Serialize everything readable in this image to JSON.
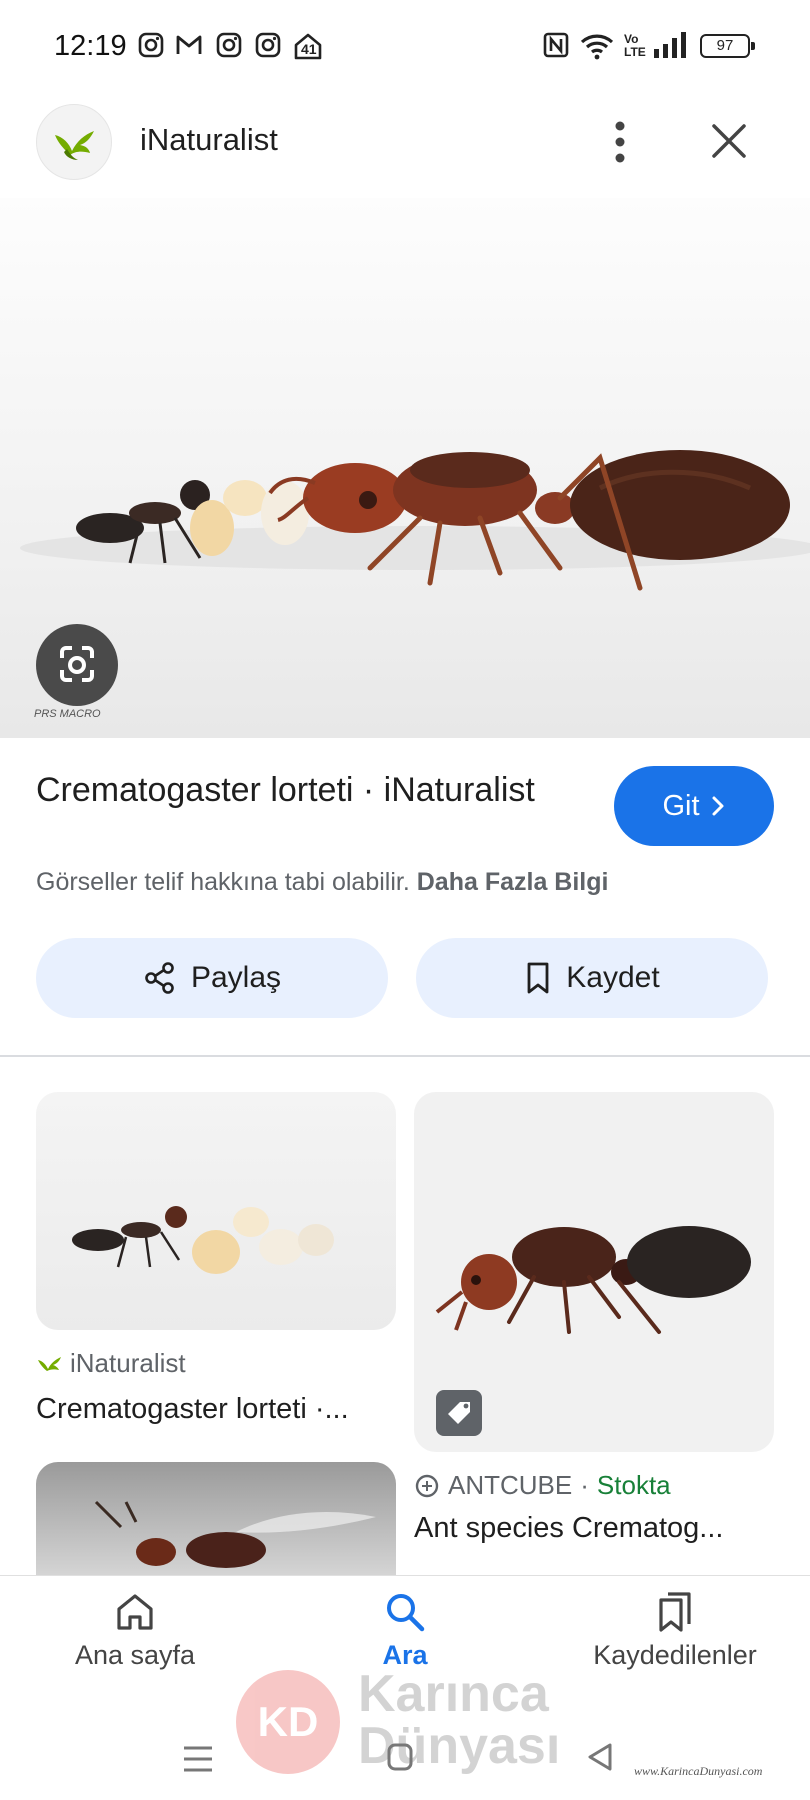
{
  "status_bar": {
    "time": "12:19",
    "battery": "97",
    "icons": [
      "instagram-icon",
      "gmail-icon",
      "instagram-icon",
      "instagram-icon",
      "home-badge-icon",
      "nfc-icon",
      "wifi-icon",
      "volte-icon",
      "signal-icon"
    ],
    "home_badge": "41",
    "volte_text": "Vo LTE"
  },
  "header": {
    "title": "iNaturalist"
  },
  "hero": {
    "watermark": "PRS MACRO"
  },
  "result": {
    "title": "Crematogaster lorteti · iNaturalist",
    "go_label": "Git",
    "copyright_text": "Görseller telif hakkına tabi olabilir.",
    "more_info_label": "Daha Fazla Bilgi",
    "share_label": "Paylaş",
    "save_label": "Kaydet"
  },
  "related": [
    {
      "source": "iNaturalist",
      "title": "Crematogaster lorteti ·..."
    },
    {
      "source": "ANTCUBE",
      "stock": "Stokta",
      "title": "Ant species Crematog..."
    }
  ],
  "bottom_nav": {
    "items": [
      {
        "label": "Ana sayfa",
        "icon": "home-icon",
        "active": false
      },
      {
        "label": "Ara",
        "icon": "search-icon",
        "active": true
      },
      {
        "label": "Kaydedilenler",
        "icon": "bookmarks-icon",
        "active": false
      }
    ]
  },
  "watermark": {
    "badge": "KD",
    "line1": "Karınca",
    "line2": "Dünyası",
    "site": "www.KarincaDunyasi.com"
  },
  "colors": {
    "accent": "#1a73e8",
    "pill_bg": "#e8f0fe",
    "stock_green": "#188038",
    "muted_text": "#5f6368"
  }
}
